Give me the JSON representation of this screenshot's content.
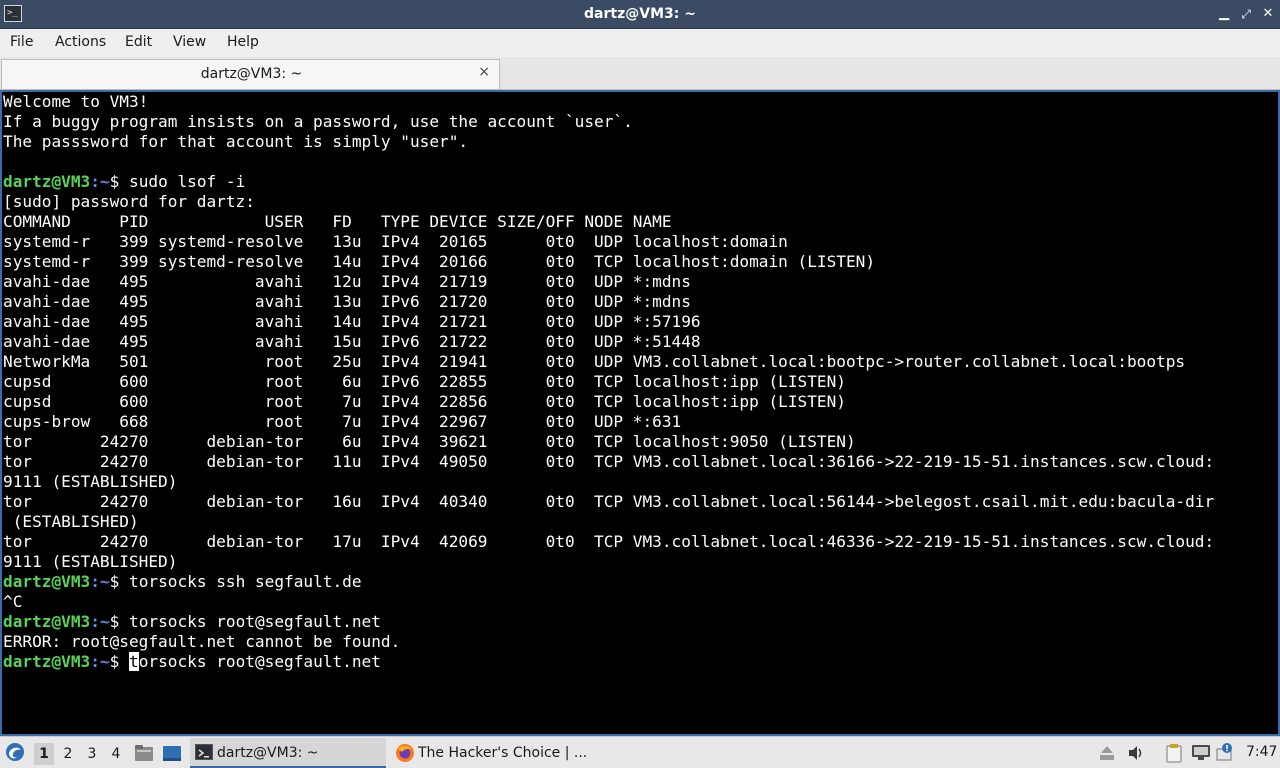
{
  "window": {
    "title": "dartz@VM3: ~",
    "icon": "terminal-icon",
    "controls": [
      "minimize-icon",
      "maximize-icon",
      "close-icon"
    ]
  },
  "menu": {
    "items": [
      "File",
      "Actions",
      "Edit",
      "View",
      "Help"
    ]
  },
  "tab": {
    "label": "dartz@VM3: ~",
    "close": "×"
  },
  "terminal": {
    "lines": [
      {
        "text": "Welcome to VM3!"
      },
      {
        "text": "If a buggy program insists on a password, use the account `user`."
      },
      {
        "text": "The passsword for that account is simply \"user\"."
      },
      {
        "text": ""
      },
      {
        "prompt_user": "dartz@VM3",
        "prompt_path": ":~",
        "prompt_sym": "$ ",
        "text": "sudo lsof -i"
      },
      {
        "text": "[sudo] password for dartz:"
      },
      {
        "text": "COMMAND     PID            USER   FD   TYPE DEVICE SIZE/OFF NODE NAME"
      },
      {
        "text": "systemd-r   399 systemd-resolve   13u  IPv4  20165      0t0  UDP localhost:domain"
      },
      {
        "text": "systemd-r   399 systemd-resolve   14u  IPv4  20166      0t0  TCP localhost:domain (LISTEN)"
      },
      {
        "text": "avahi-dae   495           avahi   12u  IPv4  21719      0t0  UDP *:mdns"
      },
      {
        "text": "avahi-dae   495           avahi   13u  IPv6  21720      0t0  UDP *:mdns"
      },
      {
        "text": "avahi-dae   495           avahi   14u  IPv4  21721      0t0  UDP *:57196"
      },
      {
        "text": "avahi-dae   495           avahi   15u  IPv6  21722      0t0  UDP *:51448"
      },
      {
        "text": "NetworkMa   501            root   25u  IPv4  21941      0t0  UDP VM3.collabnet.local:bootpc->router.collabnet.local:bootps"
      },
      {
        "text": "cupsd       600            root    6u  IPv6  22855      0t0  TCP localhost:ipp (LISTEN)"
      },
      {
        "text": "cupsd       600            root    7u  IPv4  22856      0t0  TCP localhost:ipp (LISTEN)"
      },
      {
        "text": "cups-brow   668            root    7u  IPv4  22967      0t0  UDP *:631"
      },
      {
        "text": "tor       24270      debian-tor    6u  IPv4  39621      0t0  TCP localhost:9050 (LISTEN)"
      },
      {
        "text": "tor       24270      debian-tor   11u  IPv4  49050      0t0  TCP VM3.collabnet.local:36166->22-219-15-51.instances.scw.cloud:"
      },
      {
        "text": "9111 (ESTABLISHED)"
      },
      {
        "text": "tor       24270      debian-tor   16u  IPv4  40340      0t0  TCP VM3.collabnet.local:56144->belegost.csail.mit.edu:bacula-dir"
      },
      {
        "text": " (ESTABLISHED)"
      },
      {
        "text": "tor       24270      debian-tor   17u  IPv4  42069      0t0  TCP VM3.collabnet.local:46336->22-219-15-51.instances.scw.cloud:"
      },
      {
        "text": "9111 (ESTABLISHED)"
      },
      {
        "prompt_user": "dartz@VM3",
        "prompt_path": ":~",
        "prompt_sym": "$ ",
        "text": "torsocks ssh segfault.de"
      },
      {
        "text": "^C"
      },
      {
        "prompt_user": "dartz@VM3",
        "prompt_path": ":~",
        "prompt_sym": "$ ",
        "text": "torsocks root@segfault.net"
      },
      {
        "text": "ERROR: root@segfault.net cannot be found."
      },
      {
        "prompt_user": "dartz@VM3",
        "prompt_path": ":~",
        "prompt_sym": "$ ",
        "cursor_char": "t",
        "text": "orsocks root@segfault.net"
      }
    ]
  },
  "taskbar": {
    "start_icon": "distro-logo-icon",
    "workspaces": [
      "1",
      "2",
      "3",
      "4"
    ],
    "active_workspace": "1",
    "launchers": [
      "file-manager-icon",
      "show-desktop-icon"
    ],
    "tasks": [
      {
        "label": "dartz@VM3: ~",
        "icon": "terminal-icon",
        "active": true
      },
      {
        "label": "The Hacker's Choice | ...",
        "icon": "firefox-icon",
        "active": false
      }
    ],
    "tray": [
      "removable-media-icon",
      "volume-icon",
      "clipboard-icon",
      "network-icon",
      "update-notifier-icon"
    ],
    "clock": "7:47"
  },
  "colors": {
    "titlebar": "#3a4b63",
    "prompt_user": "#55d455",
    "prompt_path": "#5b8ff0",
    "terminal_bg": "#000000",
    "terminal_fg": "#ffffff"
  }
}
